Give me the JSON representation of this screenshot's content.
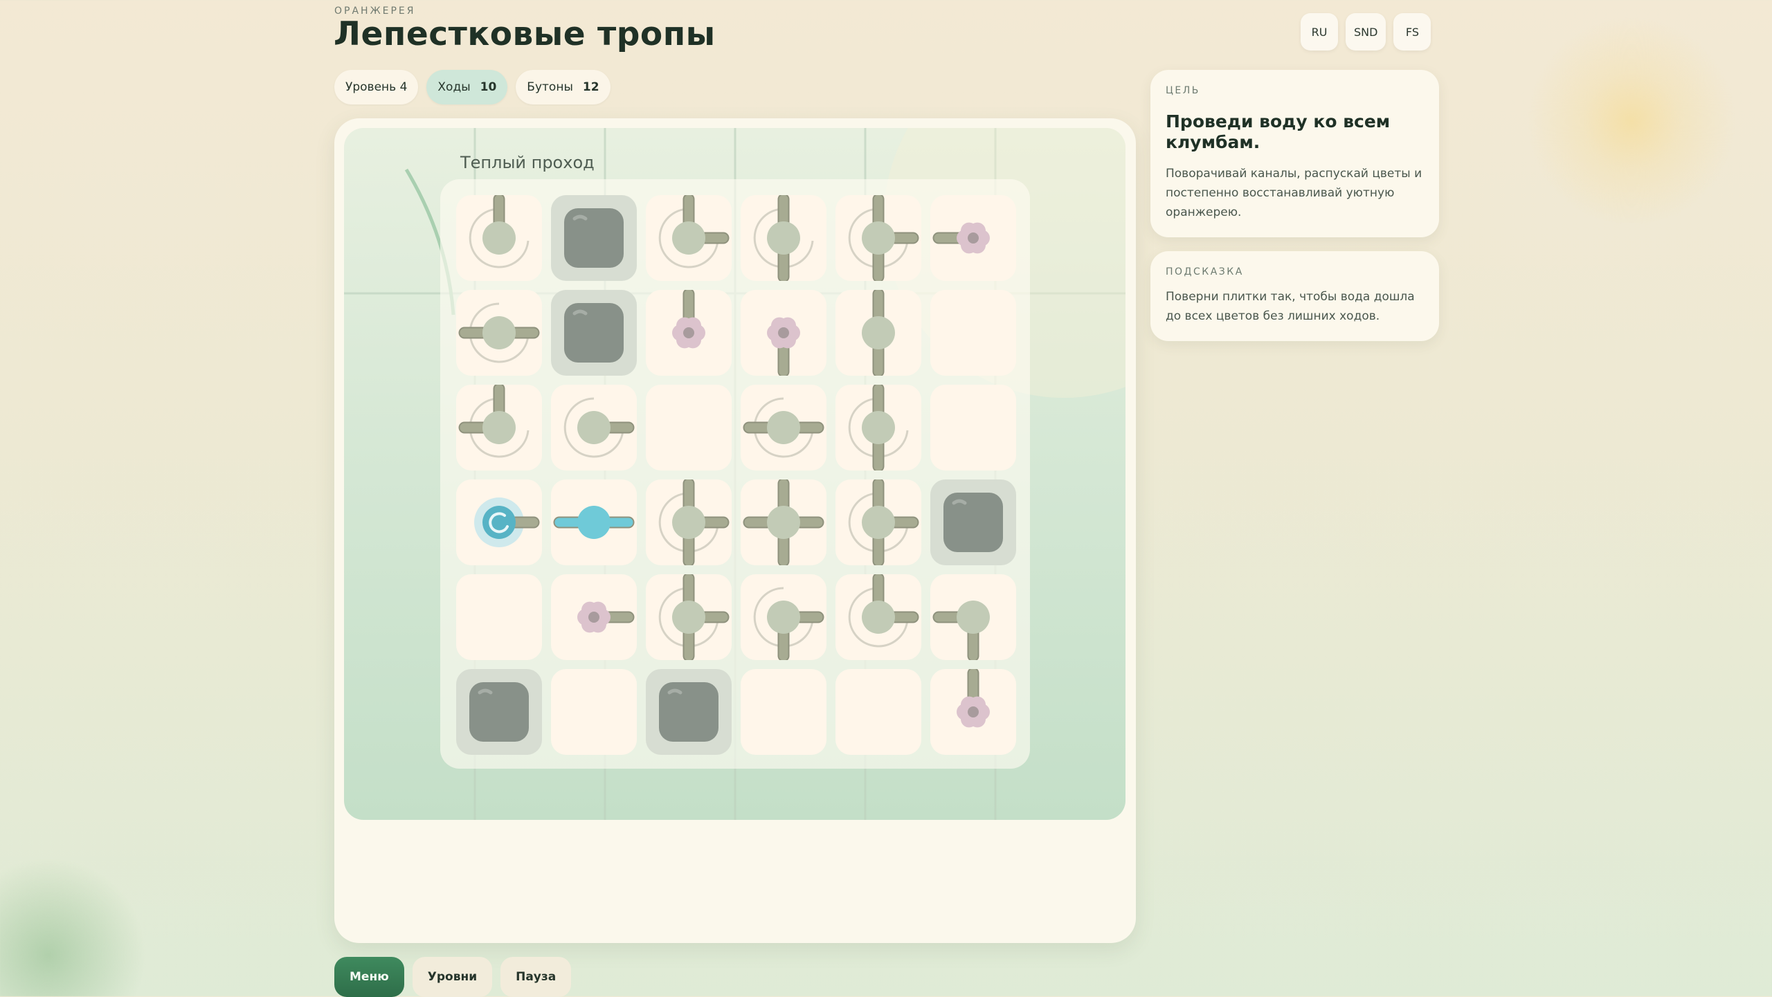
{
  "header": {
    "eyebrow": "ОРАНЖЕРЕЯ",
    "title": "Лепестковые тропы"
  },
  "stats": {
    "level": "Уровень 4",
    "moves_label": "Ходы",
    "moves_value": "10",
    "buds_label": "Бутоны",
    "buds_value": "12"
  },
  "top_buttons": {
    "lang": "RU",
    "sound": "SND",
    "fullscreen": "FS"
  },
  "board": {
    "room_label": "Теплый проход",
    "rows": 6,
    "cols": 6,
    "tiles": [
      [
        {
          "type": "pipe",
          "arms": [
            "N"
          ],
          "swirl": true
        },
        {
          "type": "rock"
        },
        {
          "type": "pipe",
          "arms": [
            "N",
            "E"
          ],
          "swirl": true
        },
        {
          "type": "pipe",
          "arms": [
            "N",
            "S"
          ],
          "swirl": true
        },
        {
          "type": "pipe",
          "arms": [
            "N",
            "S",
            "E"
          ],
          "swirl": true
        },
        {
          "type": "flower",
          "arms": [
            "W"
          ]
        }
      ],
      [
        {
          "type": "pipe",
          "arms": [
            "E",
            "W"
          ],
          "swirl": true
        },
        {
          "type": "rock"
        },
        {
          "type": "flower",
          "arms": [
            "N"
          ]
        },
        {
          "type": "flower",
          "arms": [
            "S"
          ]
        },
        {
          "type": "pipe",
          "arms": [
            "N",
            "S"
          ]
        },
        {
          "type": "empty"
        }
      ],
      [
        {
          "type": "pipe",
          "arms": [
            "N",
            "W"
          ],
          "swirl": true
        },
        {
          "type": "pipe",
          "arms": [
            "E"
          ],
          "swirl": true
        },
        {
          "type": "empty"
        },
        {
          "type": "pipe",
          "arms": [
            "E",
            "W"
          ],
          "swirl": true
        },
        {
          "type": "pipe",
          "arms": [
            "N",
            "S"
          ],
          "swirl": true
        },
        {
          "type": "empty"
        }
      ],
      [
        {
          "type": "source",
          "arms": [
            "E"
          ]
        },
        {
          "type": "pipe",
          "arms": [
            "E",
            "W"
          ],
          "water": true
        },
        {
          "type": "pipe",
          "arms": [
            "N",
            "S",
            "E"
          ],
          "swirl": true
        },
        {
          "type": "pipe",
          "arms": [
            "N",
            "S",
            "E",
            "W"
          ]
        },
        {
          "type": "pipe",
          "arms": [
            "N",
            "S",
            "E"
          ],
          "swirl": true
        },
        {
          "type": "rock"
        }
      ],
      [
        {
          "type": "empty"
        },
        {
          "type": "flower",
          "arms": [
            "E"
          ]
        },
        {
          "type": "pipe",
          "arms": [
            "N",
            "S",
            "E"
          ],
          "swirl": true
        },
        {
          "type": "pipe",
          "arms": [
            "S",
            "E"
          ],
          "swirl": true
        },
        {
          "type": "pipe",
          "arms": [
            "N",
            "E"
          ],
          "swirl": true
        },
        {
          "type": "pipe",
          "arms": [
            "S",
            "W"
          ]
        }
      ],
      [
        {
          "type": "rock"
        },
        {
          "type": "empty"
        },
        {
          "type": "rock"
        },
        {
          "type": "empty"
        },
        {
          "type": "empty"
        },
        {
          "type": "flower",
          "arms": [
            "N"
          ]
        }
      ]
    ]
  },
  "goal": {
    "caption": "ЦЕЛЬ",
    "title": "Проведи воду ко всем клумбам.",
    "text": "Поворачивай каналы, распускай цветы и постепенно восстанавливай уютную оранжерею."
  },
  "hint": {
    "caption": "ПОДСКАЗКА",
    "text": "Поверни плитки так, чтобы вода дошла до всех цветов без лишних ходов."
  },
  "bottom_buttons": {
    "menu": "Меню",
    "levels": "Уровни",
    "pause": "Пауза"
  },
  "colors": {
    "pipe": "#a7ab92",
    "pipe_core": "#c2cbb6",
    "water": "#6fcad8",
    "flower": "#dcc3cd",
    "rock": "#889189",
    "tile_bg": "#fff6ea"
  }
}
